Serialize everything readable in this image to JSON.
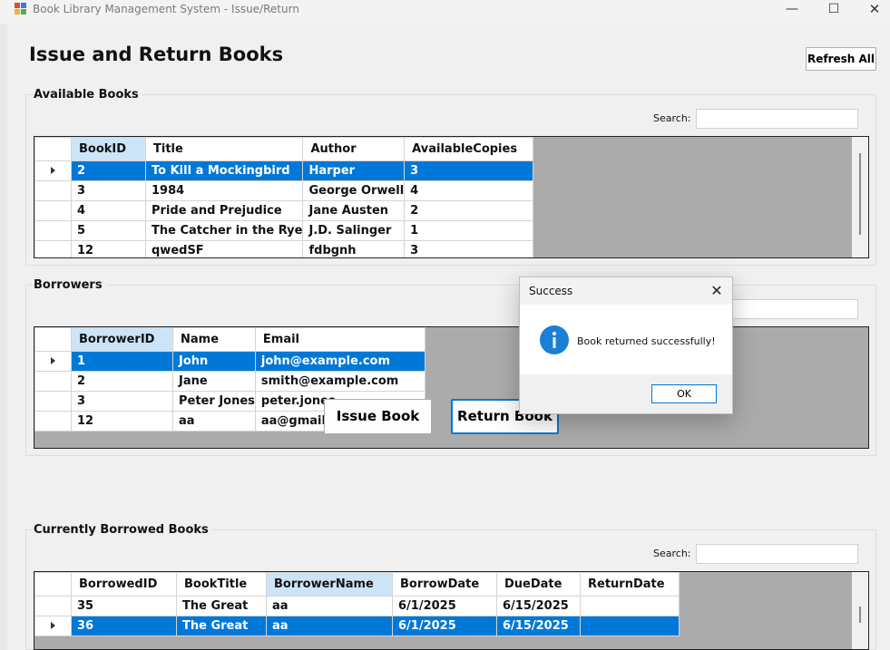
{
  "window": {
    "title": "Book Library Management System - Issue/Return",
    "minimize_glyph": "—",
    "maximize_glyph": "☐",
    "close_glyph": "✕"
  },
  "page": {
    "title": "Issue and Return Books",
    "refresh_label": "Refresh All"
  },
  "available_books": {
    "group_label": "Available Books",
    "search_label": "Search:",
    "search_value": "",
    "columns": [
      "BookID",
      "Title",
      "Author",
      "AvailableCopies"
    ],
    "sorted_column": "BookID",
    "rows": [
      [
        "2",
        "To Kill a Mockingbird",
        "Harper",
        "3"
      ],
      [
        "3",
        "1984",
        "George Orwell",
        "4"
      ],
      [
        "4",
        "Pride and Prejudice",
        "Jane Austen",
        "2"
      ],
      [
        "5",
        "The Catcher in the Rye",
        "J.D. Salinger",
        "1"
      ],
      [
        "12",
        "qwedSF",
        "fdbgnh",
        "3"
      ]
    ],
    "selected_row": 0
  },
  "borrowers": {
    "group_label": "Borrowers",
    "search_value": "",
    "columns": [
      "BorrowerID",
      "Name",
      "Email"
    ],
    "sorted_column": "BorrowerID",
    "rows": [
      [
        "1",
        "John",
        "john@example.com"
      ],
      [
        "2",
        "Jane",
        "smith@example.com"
      ],
      [
        "3",
        "Peter Jones",
        "peter.jones"
      ],
      [
        "12",
        "aa",
        "aa@gmail.c"
      ]
    ],
    "selected_row": 0
  },
  "actions": {
    "issue_label": "Issue Book",
    "return_label": "Return Book"
  },
  "borrowed_books": {
    "group_label": "Currently Borrowed Books",
    "search_label": "Search:",
    "search_value": "",
    "columns": [
      "BorrowedID",
      "BookTitle",
      "BorrowerName",
      "BorrowDate",
      "DueDate",
      "ReturnDate"
    ],
    "sorted_column": "BorrowerName",
    "rows": [
      [
        "35",
        "The Great",
        "aa",
        "6/1/2025",
        "6/15/2025",
        ""
      ],
      [
        "36",
        "The Great",
        "aa",
        "6/1/2025",
        "6/15/2025",
        ""
      ]
    ],
    "selected_row": 1
  },
  "dialog": {
    "title": "Success",
    "message": "Book returned successfully!",
    "ok_label": "OK",
    "icon": "info-icon",
    "icon_glyph": "i"
  },
  "colors": {
    "selection": "#0078d7",
    "sorted_header": "#cce4f7",
    "grid_background": "#ababab",
    "window_background": "#f0f0f0",
    "info_icon": "#1a7fd6"
  }
}
